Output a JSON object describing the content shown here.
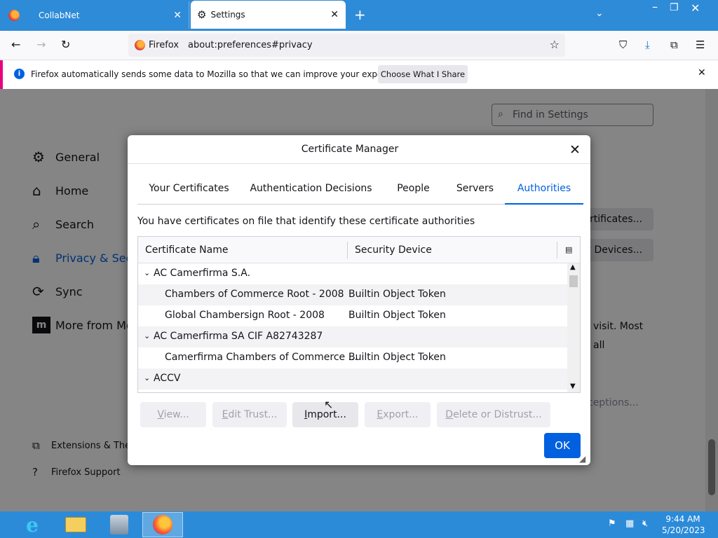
{
  "browser": {
    "tabs": [
      {
        "label": "CollabNet"
      },
      {
        "label": "Settings"
      }
    ],
    "identity_label": "Firefox",
    "url": "about:preferences#privacy"
  },
  "notification": {
    "message": "Firefox automatically sends some data to Mozilla so that we can improve your experience.",
    "button": "Choose What I Share"
  },
  "settings": {
    "search_placeholder": "Find in Settings",
    "categories": [
      {
        "label": "General",
        "icon": "gear-icon"
      },
      {
        "label": "Home",
        "icon": "home-icon"
      },
      {
        "label": "Search",
        "icon": "search-icon"
      },
      {
        "label": "Privacy & Secu",
        "icon": "lock-icon"
      },
      {
        "label": "Sync",
        "icon": "sync-icon"
      },
      {
        "label": "More from Mo",
        "icon": "mozilla-icon"
      }
    ],
    "footer_links": [
      {
        "label": "Extensions & The",
        "icon": "puzzle-icon"
      },
      {
        "label": "Firefox Support",
        "icon": "help-icon"
      }
    ],
    "bg_buttons": [
      "ertificates...",
      "y Devices..."
    ],
    "bg_text1": "visit. Most",
    "bg_text2": "all",
    "bg_exceptions": "ceptions..."
  },
  "dialog": {
    "title": "Certificate Manager",
    "tabs": [
      {
        "label": "Your Certificates",
        "selected": false
      },
      {
        "label": "Authentication Decisions",
        "selected": false
      },
      {
        "label": "People",
        "selected": false
      },
      {
        "label": "Servers",
        "selected": false
      },
      {
        "label": "Authorities",
        "selected": true
      }
    ],
    "intro": "You have certificates on file that identify these certificate authorities",
    "columns": [
      "Certificate Name",
      "Security Device"
    ],
    "rows": [
      {
        "type": "group",
        "name": "AC Camerfirma S.A.",
        "device": ""
      },
      {
        "type": "cert",
        "name": "Chambers of Commerce Root - 2008",
        "device": "Builtin Object Token"
      },
      {
        "type": "cert",
        "name": "Global Chambersign Root - 2008",
        "device": "Builtin Object Token"
      },
      {
        "type": "group",
        "name": "AC Camerfirma SA CIF A82743287",
        "device": ""
      },
      {
        "type": "cert",
        "name": "Camerfirma Chambers of Commerce ...",
        "device": "Builtin Object Token"
      },
      {
        "type": "group",
        "name": "ACCV",
        "device": ""
      }
    ],
    "buttons": [
      {
        "label": "View...",
        "enabled": false
      },
      {
        "label": "Edit Trust...",
        "enabled": false
      },
      {
        "label": "Import...",
        "enabled": true
      },
      {
        "label": "Export...",
        "enabled": false
      },
      {
        "label": "Delete or Distrust...",
        "enabled": false
      }
    ],
    "ok": "OK"
  },
  "taskbar": {
    "apps": [
      "internet-explorer-icon",
      "file-explorer-icon",
      "app-icon",
      "firefox-icon"
    ],
    "time": "9:44 AM",
    "date": "5/20/2023"
  },
  "colors": {
    "accent": "#0060df",
    "titlebar": "#2e8bd8",
    "taskbar": "#2b8bd9",
    "notice_stripe": "#e9007f"
  }
}
